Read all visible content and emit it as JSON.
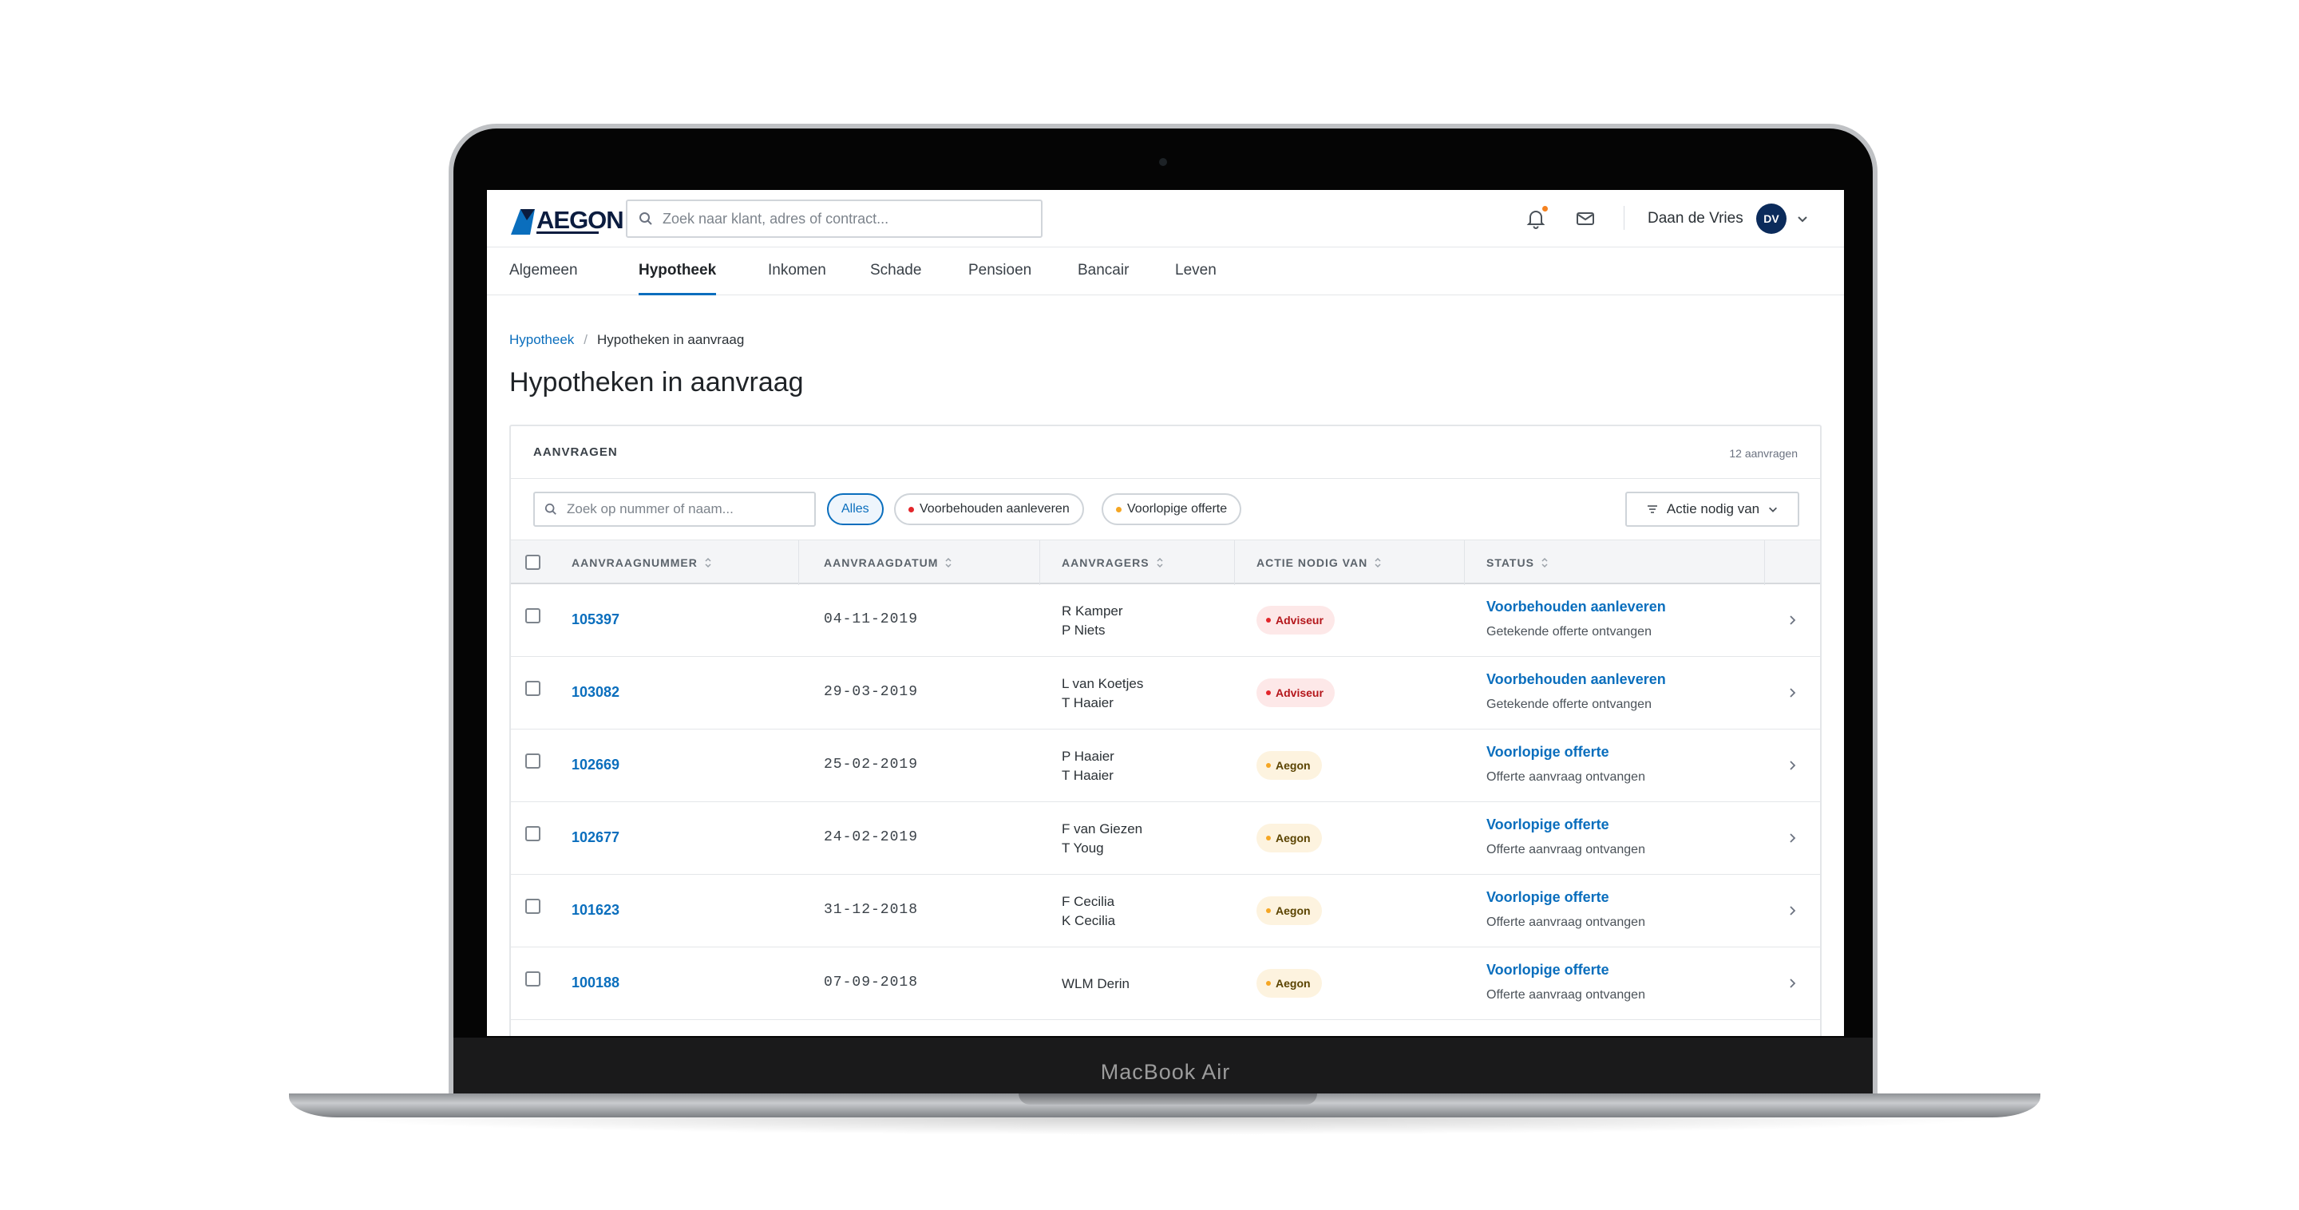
{
  "device": {
    "brand": "MacBook Air"
  },
  "header": {
    "logo_text": "AEGON",
    "search_placeholder": "Zoek naar klant, adres of contract...",
    "user_name": "Daan de Vries",
    "avatar_initials": "DV",
    "notification_dot_color": "#f58220"
  },
  "nav": {
    "tabs": [
      {
        "label": "Algemeen"
      },
      {
        "label": "Hypotheek",
        "active": true
      },
      {
        "label": "Inkomen"
      },
      {
        "label": "Schade"
      },
      {
        "label": "Pensioen"
      },
      {
        "label": "Bancair"
      },
      {
        "label": "Leven"
      }
    ]
  },
  "breadcrumb": {
    "parent": "Hypotheek",
    "separator": "/",
    "current": "Hypotheken in aanvraag"
  },
  "page_title": "Hypotheken in aanvraag",
  "card": {
    "label": "AANVRAGEN",
    "count": "12 aanvragen",
    "filter_placeholder": "Zoek op nummer of naam...",
    "chips": [
      {
        "label": "Alles",
        "active": true
      },
      {
        "label": "Voorbehouden aanleveren",
        "dot_color": "#e3262b"
      },
      {
        "label": "Voorlopige offerte",
        "dot_color": "#f5a623"
      }
    ],
    "action_button": "Actie nodig van"
  },
  "table": {
    "columns": [
      "AANVRAAGNUMMER",
      "AANVRAAGDATUM",
      "AANVRAGERS",
      "ACTIE NODIG VAN",
      "STATUS"
    ],
    "rows": [
      {
        "number": "105397",
        "date": "04-11-2019",
        "applicant1": "R Kamper",
        "applicant2": "P Niets",
        "action": "Adviseur",
        "status_title": "Voorbehouden aanleveren",
        "status_sub": "Getekende offerte ontvangen"
      },
      {
        "number": "103082",
        "date": "29-03-2019",
        "applicant1": "L van Koetjes",
        "applicant2": "T Haaier",
        "action": "Adviseur",
        "status_title": "Voorbehouden aanleveren",
        "status_sub": "Getekende offerte ontvangen"
      },
      {
        "number": "102669",
        "date": "25-02-2019",
        "applicant1": "P Haaier",
        "applicant2": "T Haaier",
        "action": "Aegon",
        "status_title": "Voorlopige offerte",
        "status_sub": "Offerte aanvraag ontvangen"
      },
      {
        "number": "102677",
        "date": "24-02-2019",
        "applicant1": "F van Giezen",
        "applicant2": "T Youg",
        "action": "Aegon",
        "status_title": "Voorlopige offerte",
        "status_sub": "Offerte aanvraag ontvangen"
      },
      {
        "number": "101623",
        "date": "31-12-2018",
        "applicant1": "F Cecilia",
        "applicant2": "K Cecilia",
        "action": "Aegon",
        "status_title": "Voorlopige offerte",
        "status_sub": "Offerte aanvraag ontvangen"
      },
      {
        "number": "100188",
        "date": "07-09-2018",
        "applicant1": "WLM Derin",
        "applicant2": "",
        "action": "Aegon",
        "status_title": "Voorlopige offerte",
        "status_sub": "Offerte aanvraag ontvangen"
      }
    ]
  },
  "colors": {
    "accent": "#0a6ebd",
    "adviseur_badge_bg": "#fde8e8",
    "adviseur_badge_text": "#b4161b",
    "adviseur_dot": "#e3262b",
    "aegon_badge_bg": "#fdf3df",
    "aegon_badge_text": "#5a4300",
    "aegon_dot": "#f5a623"
  }
}
